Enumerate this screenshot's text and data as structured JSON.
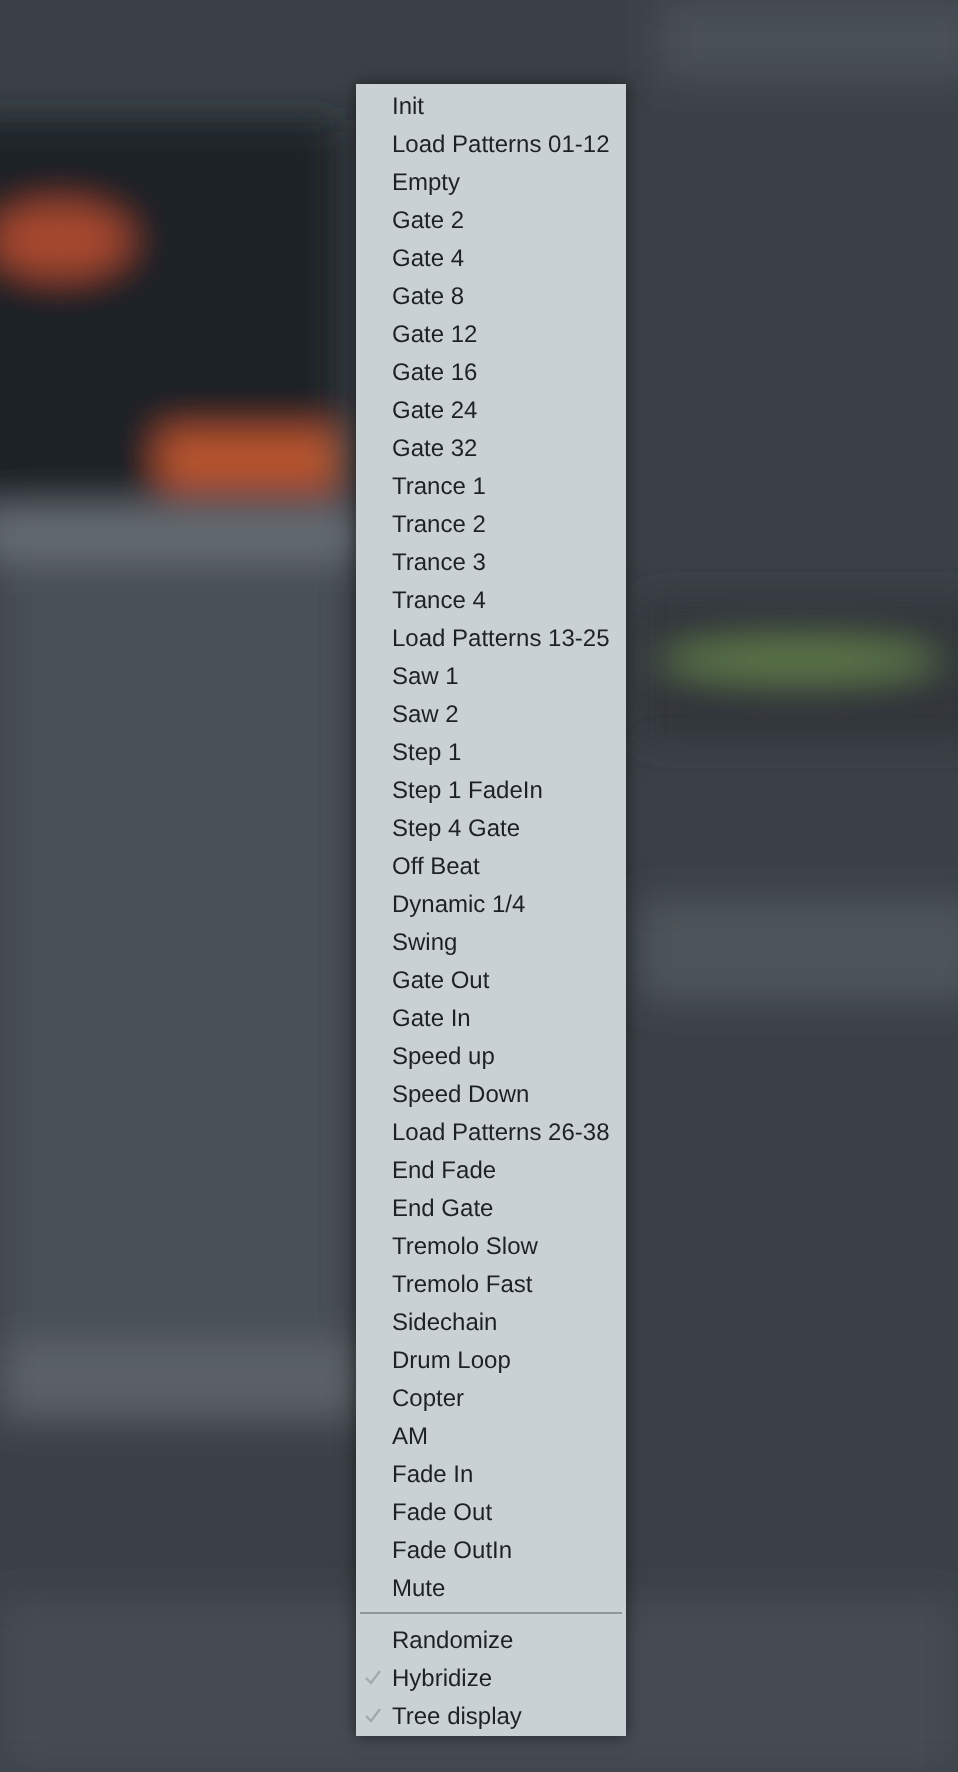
{
  "menu": {
    "presets": [
      {
        "label": "Init"
      },
      {
        "label": "Load Patterns 01-12"
      },
      {
        "label": "Empty"
      },
      {
        "label": "Gate 2"
      },
      {
        "label": "Gate 4"
      },
      {
        "label": "Gate 8"
      },
      {
        "label": "Gate 12"
      },
      {
        "label": "Gate 16"
      },
      {
        "label": "Gate 24"
      },
      {
        "label": "Gate 32"
      },
      {
        "label": "Trance 1"
      },
      {
        "label": "Trance 2"
      },
      {
        "label": "Trance 3"
      },
      {
        "label": "Trance 4"
      },
      {
        "label": "Load Patterns 13-25"
      },
      {
        "label": "Saw 1"
      },
      {
        "label": "Saw 2"
      },
      {
        "label": "Step 1"
      },
      {
        "label": "Step 1 FadeIn"
      },
      {
        "label": "Step 4 Gate"
      },
      {
        "label": "Off Beat"
      },
      {
        "label": "Dynamic 1/4"
      },
      {
        "label": "Swing"
      },
      {
        "label": "Gate Out"
      },
      {
        "label": "Gate In"
      },
      {
        "label": "Speed up"
      },
      {
        "label": "Speed Down"
      },
      {
        "label": "Load Patterns 26-38"
      },
      {
        "label": "End Fade"
      },
      {
        "label": "End Gate"
      },
      {
        "label": "Tremolo Slow"
      },
      {
        "label": "Tremolo Fast"
      },
      {
        "label": "Sidechain"
      },
      {
        "label": "Drum Loop"
      },
      {
        "label": "Copter"
      },
      {
        "label": "AM"
      },
      {
        "label": "Fade In"
      },
      {
        "label": "Fade Out"
      },
      {
        "label": "Fade OutIn"
      },
      {
        "label": "Mute"
      }
    ],
    "options": [
      {
        "label": "Randomize",
        "checked": false
      },
      {
        "label": "Hybridize",
        "checked": true
      },
      {
        "label": "Tree display",
        "checked": true
      }
    ]
  }
}
